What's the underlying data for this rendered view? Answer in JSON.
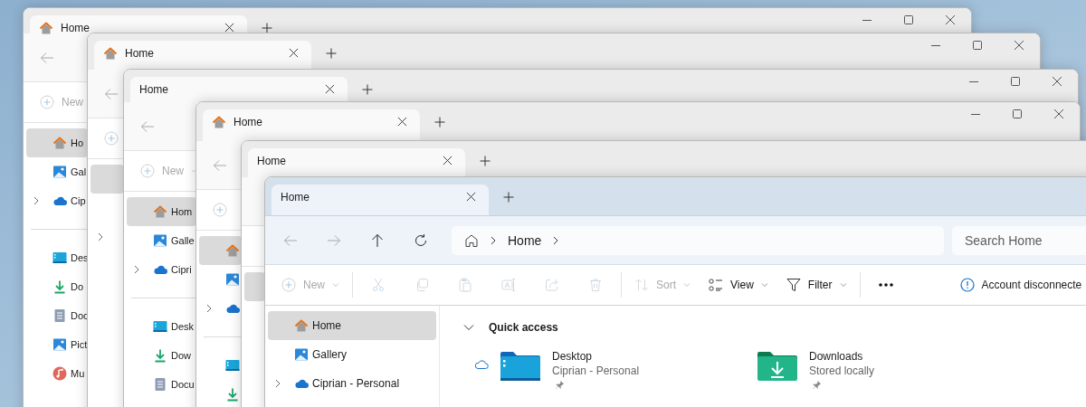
{
  "windows": [
    {
      "active": false,
      "controls": true,
      "tab": {
        "label": "Home",
        "icon": true
      },
      "nav": [
        {
          "kind": "back",
          "disabled": true
        }
      ],
      "toolbar": [
        {
          "kind": "new",
          "label": "New",
          "disabled": true,
          "dropdown": false
        }
      ],
      "sidebar": {
        "items": [
          {
            "kind": "home",
            "label": "Ho",
            "selected": true,
            "expandable": false
          },
          {
            "kind": "gallery",
            "label": "Gal",
            "selected": false,
            "expandable": false
          },
          {
            "kind": "cloud",
            "label": "Cip",
            "selected": false,
            "expandable": true
          }
        ],
        "folders": [
          {
            "kind": "desktop",
            "label": "Des",
            "selected": false
          },
          {
            "kind": "downloads",
            "label": "Do",
            "selected": false
          },
          {
            "kind": "documents",
            "label": "Doc",
            "selected": false
          },
          {
            "kind": "pictures",
            "label": "Pict",
            "selected": false
          },
          {
            "kind": "music",
            "label": "Mu",
            "selected": false
          }
        ]
      }
    },
    {
      "active": false,
      "controls": true,
      "tab": {
        "label": "Home",
        "icon": true
      },
      "nav": [
        {
          "kind": "back",
          "disabled": true
        }
      ],
      "toolbar": [
        {
          "kind": "new",
          "disabled": true,
          "dropdown": false
        }
      ],
      "sidebar": {
        "items": [
          {
            "selected": true,
            "expandable": false
          },
          {
            "selected": false,
            "expandable": false
          },
          {
            "selected": false,
            "expandable": true
          }
        ]
      }
    },
    {
      "active": false,
      "controls": true,
      "tab": {
        "label": "Home",
        "icon": false
      },
      "nav": [
        {
          "kind": "back",
          "disabled": true
        }
      ],
      "toolbar": [
        {
          "kind": "new",
          "label": "New",
          "disabled": true,
          "dropdown": true
        }
      ],
      "sidebar": {
        "items": [
          {
            "kind": "home",
            "label": "Hom",
            "selected": true,
            "expandable": false
          },
          {
            "kind": "gallery",
            "label": "Galle",
            "selected": false,
            "expandable": false
          },
          {
            "kind": "cloud",
            "label": "Cipri",
            "selected": false,
            "expandable": true
          }
        ],
        "folders": [
          {
            "kind": "desktop",
            "label": "Desk",
            "selected": false
          },
          {
            "kind": "downloads",
            "label": "Dow",
            "selected": false
          },
          {
            "kind": "documents",
            "label": "Docu",
            "selected": false
          }
        ]
      }
    },
    {
      "active": false,
      "controls": true,
      "tab": {
        "label": "Home",
        "icon": true
      },
      "nav": [
        {
          "kind": "back",
          "disabled": true
        }
      ],
      "toolbar": [
        {
          "kind": "new",
          "disabled": true,
          "dropdown": false
        }
      ],
      "sidebar": {
        "items": [
          {
            "kind": "home",
            "selected": true,
            "expandable": false
          },
          {
            "kind": "gallery",
            "selected": false,
            "expandable": false
          },
          {
            "kind": "cloud",
            "selected": false,
            "expandable": true
          }
        ],
        "folders": [
          {
            "kind": "desktop",
            "selected": false
          },
          {
            "kind": "downloads",
            "selected": false
          }
        ]
      }
    },
    {
      "active": false,
      "controls": false,
      "tab": {
        "label": "Home",
        "icon": false
      },
      "sidebar": {
        "items": [
          {
            "selected": true,
            "expandable": false
          }
        ]
      }
    },
    {
      "active": true,
      "controls": false,
      "tab": {
        "label": "Home",
        "icon": false
      },
      "nav": [
        {
          "kind": "back",
          "disabled": true
        },
        {
          "kind": "forward",
          "disabled": true
        },
        {
          "kind": "up",
          "disabled": false
        },
        {
          "kind": "refresh",
          "disabled": false
        }
      ],
      "address": {
        "crumbs": [
          "Home"
        ]
      },
      "search": {
        "placeholder": "Search Home"
      },
      "toolbar": [
        {
          "kind": "new",
          "label": "New",
          "disabled": true,
          "dropdown": true
        },
        {
          "kind": "cut",
          "disabled": true
        },
        {
          "kind": "copy",
          "disabled": true
        },
        {
          "kind": "paste",
          "disabled": true
        },
        {
          "kind": "rename",
          "disabled": true
        },
        {
          "kind": "share",
          "disabled": true
        },
        {
          "kind": "delete",
          "disabled": true
        },
        {
          "kind": "sort",
          "label": "Sort",
          "disabled": true,
          "dropdown": true
        },
        {
          "kind": "view",
          "label": "View",
          "disabled": false,
          "dropdown": true
        },
        {
          "kind": "filter",
          "label": "Filter",
          "disabled": false,
          "dropdown": true
        },
        {
          "kind": "more"
        }
      ],
      "status": {
        "label": "Account disconnecte"
      },
      "sidebar": {
        "items": [
          {
            "kind": "home",
            "label": "Home",
            "selected": true,
            "expandable": false
          },
          {
            "kind": "gallery",
            "label": "Gallery",
            "selected": false,
            "expandable": false
          },
          {
            "kind": "cloud",
            "label": "Ciprian - Personal",
            "selected": false,
            "expandable": true
          }
        ]
      },
      "content": {
        "section": {
          "label": "Quick access",
          "expanded": true
        },
        "items": [
          {
            "kind": "desktop",
            "name": "Desktop",
            "detail": "Ciprian - Personal",
            "cloud": true,
            "pinned": true
          },
          {
            "kind": "downloads",
            "name": "Downloads",
            "detail": "Stored locally",
            "cloud": false,
            "pinned": true
          }
        ]
      }
    }
  ]
}
